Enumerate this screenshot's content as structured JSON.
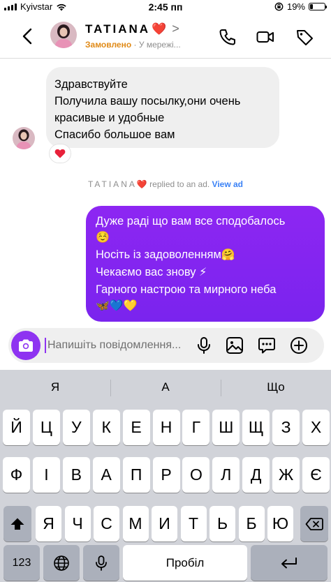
{
  "status_bar": {
    "carrier": "Kyivstar",
    "time": "2:45 пп",
    "battery": "19%",
    "battery_level": 0.19
  },
  "header": {
    "name": "TATIANA",
    "name_emoji": "❤️",
    "chevron": ">",
    "order_status": "Замовлено",
    "separator": " · ",
    "online_status": "У мережі..."
  },
  "messages": {
    "incoming": {
      "lines": [
        "Здравствуйте",
        "Получила вашу посылку,они очень",
        "красивые и удобные",
        "Спасибо большое вам"
      ],
      "reaction": "❤️"
    },
    "reply_note": {
      "name": "TATIANA",
      "emoji": "❤️",
      "text": " replied to an ad. ",
      "link": "View ad"
    },
    "outgoing": {
      "line1": "Дуже раді що вам все сподобалось",
      "line2": "☺️",
      "line3_text": "Носіть із задоволенням",
      "line3_emoji": "🤗",
      "line4_text": "Чекаємо вас знову ",
      "line4_emoji": "⚡",
      "line5": "Гарного настрою та мирного неба",
      "line6": "🦋💙💛"
    }
  },
  "composer": {
    "placeholder": "Напишіть повідомлення..."
  },
  "keyboard": {
    "suggestions": [
      "Я",
      "А",
      "Що"
    ],
    "row1": [
      "Й",
      "Ц",
      "У",
      "К",
      "Е",
      "Н",
      "Г",
      "Ш",
      "Щ",
      "З",
      "Х"
    ],
    "row2": [
      "Ф",
      "І",
      "В",
      "А",
      "П",
      "Р",
      "О",
      "Л",
      "Д",
      "Ж",
      "Є"
    ],
    "row3": [
      "Я",
      "Ч",
      "С",
      "М",
      "И",
      "Т",
      "Ь",
      "Б",
      "Ю"
    ],
    "numbers_label": "123",
    "space_label": "Пробіл"
  },
  "colors": {
    "accent": "#8e33f1",
    "bubble_out": "#8326f0",
    "bubble_in": "#efefef",
    "order_status": "#e08a17",
    "link": "#3b82f6",
    "keyboard_bg": "#d1d3d9"
  },
  "icons": [
    "back-arrow-icon",
    "phone-icon",
    "video-camera-icon",
    "tag-icon",
    "camera-icon",
    "microphone-icon",
    "image-icon",
    "sticker-icon",
    "plus-icon",
    "shift-icon",
    "backspace-icon",
    "globe-icon",
    "return-icon",
    "wifi-icon",
    "lock-rotation-icon"
  ]
}
